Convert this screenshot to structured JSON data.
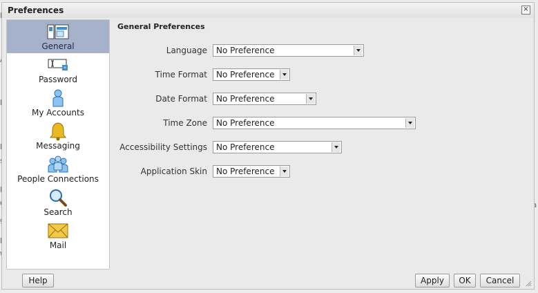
{
  "dialog": {
    "title": "Preferences",
    "close_glyph": "×"
  },
  "background_text": [
    "R",
    "A",
    "R",
    "R",
    "s",
    "R",
    "C",
    "g",
    "R",
    "W",
    "ra"
  ],
  "sidebar": {
    "items": [
      {
        "label": "General",
        "icon": "general-prefs-icon",
        "active": true
      },
      {
        "label": "Password",
        "icon": "password-icon",
        "active": false
      },
      {
        "label": "My Accounts",
        "icon": "user-icon",
        "active": false
      },
      {
        "label": "Messaging",
        "icon": "bell-icon",
        "active": false
      },
      {
        "label": "People Connections",
        "icon": "people-icon",
        "active": false
      },
      {
        "label": "Search",
        "icon": "magnifier-icon",
        "active": false
      },
      {
        "label": "Mail",
        "icon": "envelope-icon",
        "active": false
      }
    ]
  },
  "general": {
    "title": "General Preferences",
    "rows": [
      {
        "label": "Language",
        "value": "No Preference"
      },
      {
        "label": "Time Format",
        "value": "No Preference"
      },
      {
        "label": "Date Format",
        "value": "No Preference"
      },
      {
        "label": "Time Zone",
        "value": "No Preference"
      },
      {
        "label": "Accessibility Settings",
        "value": "No Preference"
      },
      {
        "label": "Application Skin",
        "value": "No Preference"
      }
    ]
  },
  "buttons": {
    "help": "Help",
    "apply": "Apply",
    "ok": "OK",
    "cancel": "Cancel"
  },
  "colors": {
    "active_nav": "#a6b2c9",
    "icon_blue": "#3d8fd6",
    "bell_gold": "#e8b923",
    "envelope": "#f2c74a"
  }
}
